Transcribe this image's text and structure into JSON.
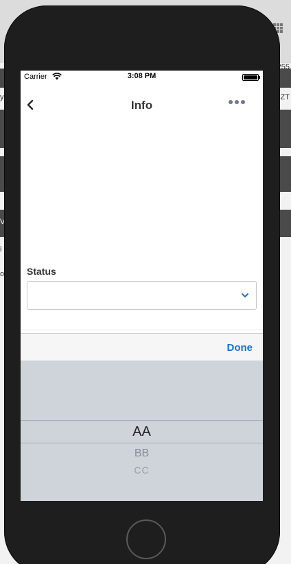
{
  "background": {
    "text_1": "255",
    "text_2": "ZT",
    "text_3": "y",
    "text_4": "V",
    "text_5": "i",
    "text_6": "o"
  },
  "status_bar": {
    "carrier": "Carrier",
    "time": "3:08 PM"
  },
  "nav": {
    "title": "Info"
  },
  "form": {
    "status_label": "Status",
    "status_value": ""
  },
  "picker": {
    "done_label": "Done",
    "options": [
      "AA",
      "BB",
      "CC"
    ],
    "selected": "AA"
  },
  "colors": {
    "accent": "#1273d8",
    "picker_bg": "#cfd3da",
    "more_icon": "#6b7a95"
  }
}
